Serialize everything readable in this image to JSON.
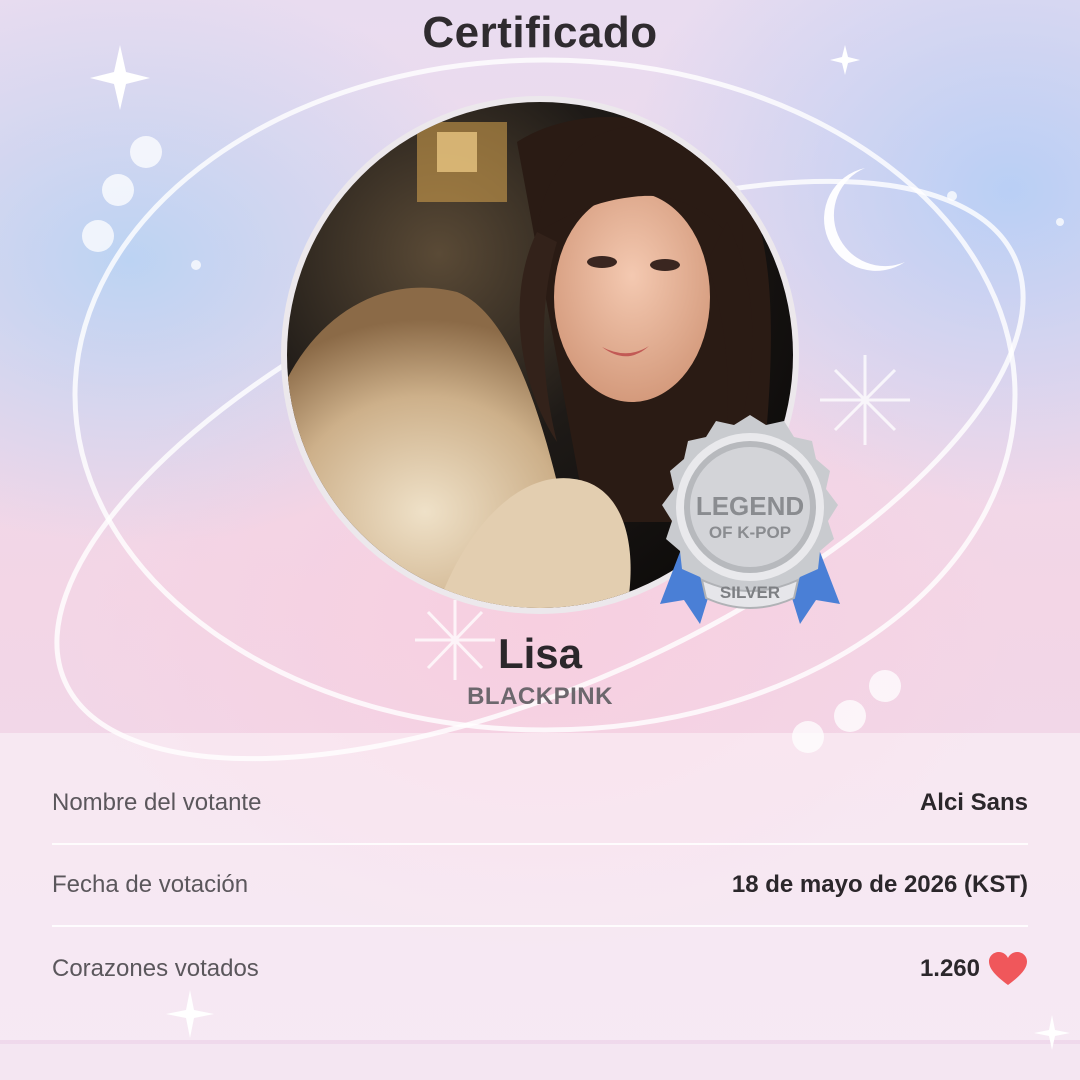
{
  "header": {
    "title": "Certificado"
  },
  "artist": {
    "name": "Lisa",
    "group": "BLACKPINK"
  },
  "badge": {
    "line1": "LEGEND",
    "line2": "OF K-POP",
    "tier": "SILVER"
  },
  "details": {
    "rows": [
      {
        "label": "Nombre del votante",
        "value": "Alci Sans"
      },
      {
        "label": "Fecha de votación",
        "value": "18 de mayo de 2026 (KST)"
      },
      {
        "label": "Corazones votados",
        "value": "1.260",
        "icon": "heart-icon"
      }
    ]
  },
  "colors": {
    "heart": "#f0575b",
    "ribbon": "#4a7fd6",
    "badge_silver": "#c9cbcf"
  }
}
